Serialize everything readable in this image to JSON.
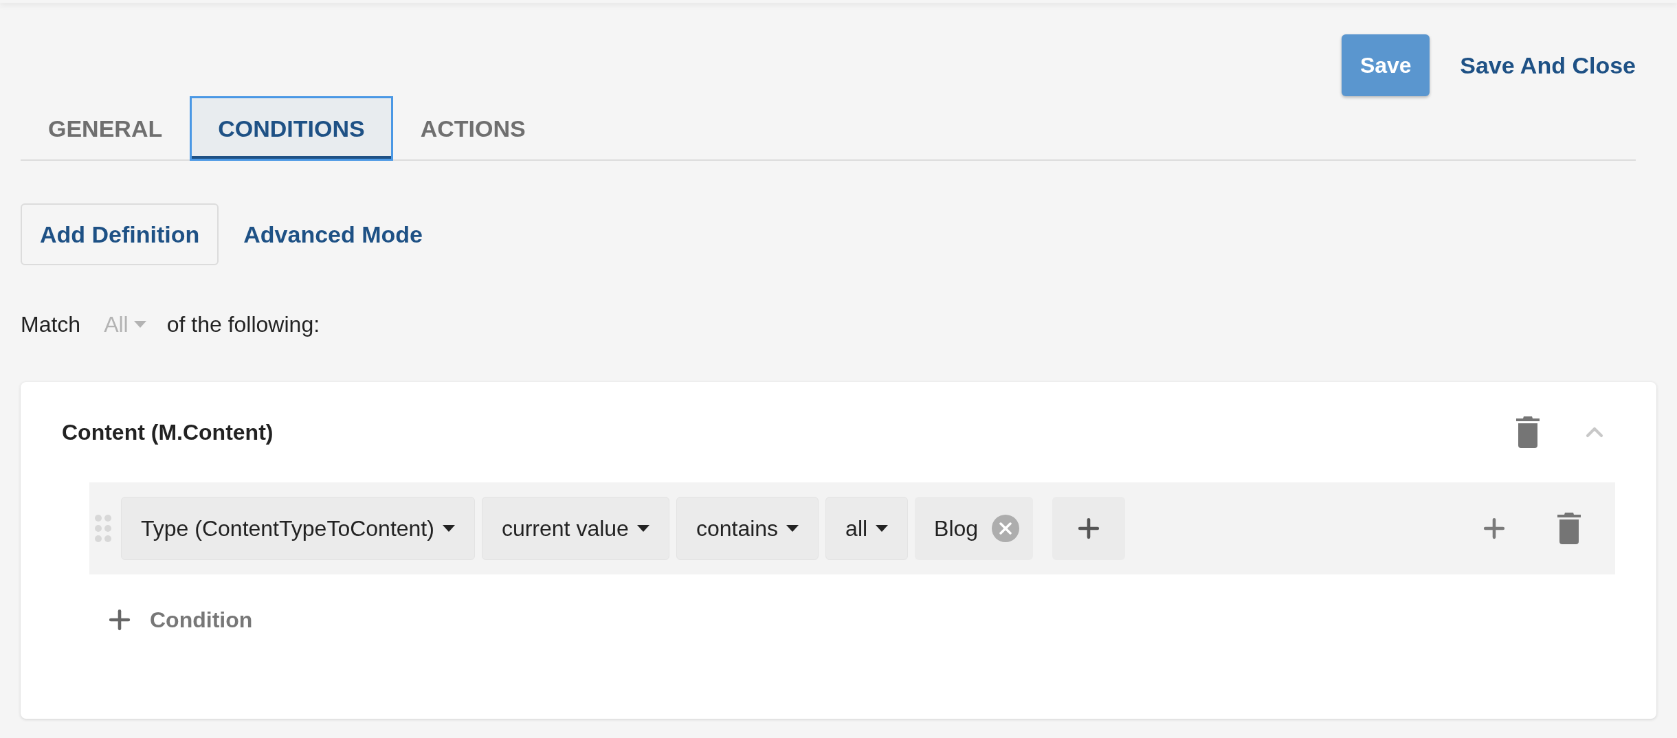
{
  "header_actions": {
    "save": "Save",
    "save_and_close": "Save And Close"
  },
  "tabs": [
    {
      "label": "GENERAL",
      "selected": false
    },
    {
      "label": "CONDITIONS",
      "selected": true
    },
    {
      "label": "ACTIONS",
      "selected": false
    }
  ],
  "toolbar": {
    "add_definition": "Add Definition",
    "advanced_mode": "Advanced Mode"
  },
  "match": {
    "prefix": "Match",
    "value": "All",
    "suffix": "of the following:"
  },
  "definition": {
    "title": "Content (M.Content)",
    "expanded": true,
    "conditions": [
      {
        "parts": [
          {
            "kind": "dropdown",
            "label": "Type (ContentTypeToContent)"
          },
          {
            "kind": "dropdown",
            "label": "current value"
          },
          {
            "kind": "dropdown",
            "label": "contains"
          },
          {
            "kind": "dropdown",
            "label": "all"
          },
          {
            "kind": "tag",
            "label": "Blog"
          }
        ]
      }
    ],
    "add_condition": "Condition"
  }
}
